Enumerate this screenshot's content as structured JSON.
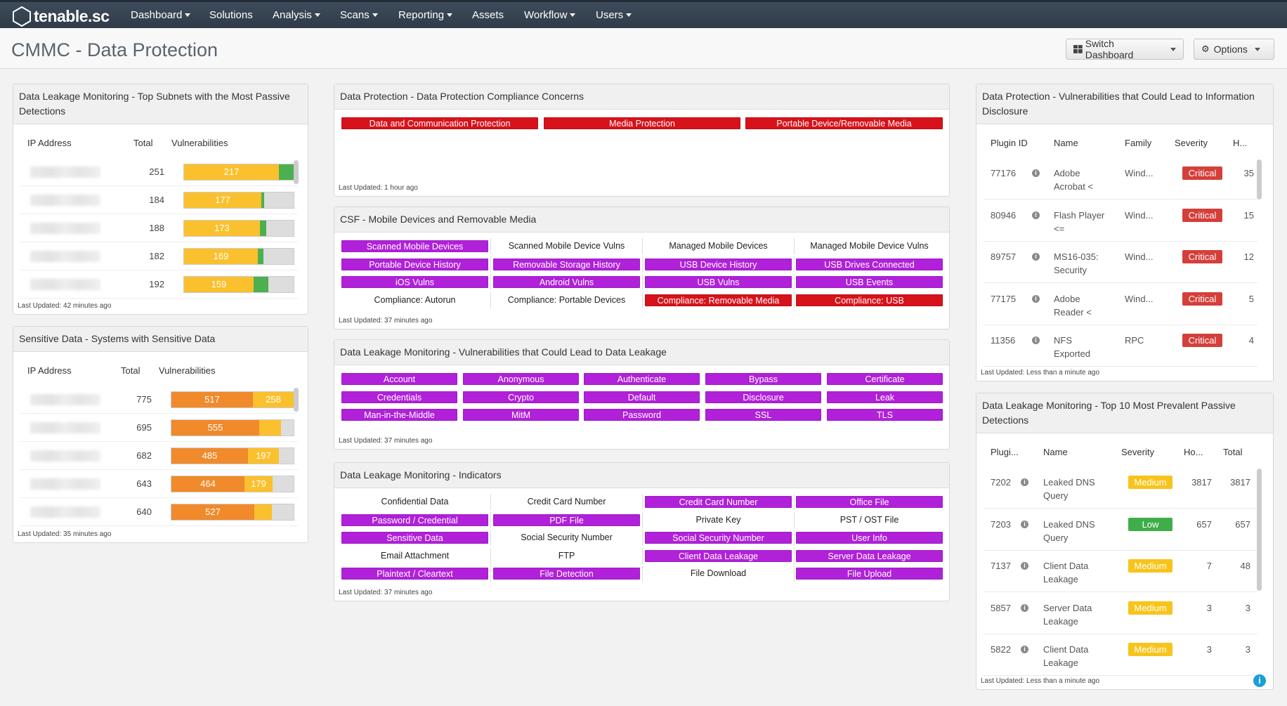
{
  "app": {
    "logo": "tenable.sc"
  },
  "nav": [
    "Dashboard",
    "Solutions",
    "Analysis",
    "Scans",
    "Reporting",
    "Assets",
    "Workflow",
    "Users"
  ],
  "page": {
    "title": "CMMC - Data Protection",
    "switch": "Switch Dashboard",
    "options": "Options"
  },
  "p1": {
    "title": "Data Leakage Monitoring - Top Subnets with the Most Passive Detections",
    "cols": [
      "IP Address",
      "Total",
      "Vulnerabilities"
    ],
    "footer": "Last Updated: 42 minutes ago",
    "rows": [
      {
        "total": "251",
        "vuln": 217,
        "label": "217"
      },
      {
        "total": "184",
        "vuln": 177,
        "label": "177"
      },
      {
        "total": "188",
        "vuln": 173,
        "label": "173"
      },
      {
        "total": "182",
        "vuln": 169,
        "label": "169"
      },
      {
        "total": "192",
        "vuln": 159,
        "label": "159"
      }
    ]
  },
  "p2": {
    "title": "Sensitive Data - Systems with Sensitive Data",
    "cols": [
      "IP Address",
      "Total",
      "Vulnerabilities"
    ],
    "footer": "Last Updated: 35 minutes ago",
    "rows": [
      {
        "total": "775",
        "a": 517,
        "b": 258,
        "la": "517",
        "lb": "258"
      },
      {
        "total": "695",
        "a": 555,
        "b": 0,
        "la": "555",
        "lb": ""
      },
      {
        "total": "682",
        "a": 485,
        "b": 197,
        "la": "485",
        "lb": "197"
      },
      {
        "total": "643",
        "a": 464,
        "b": 179,
        "la": "464",
        "lb": "179"
      },
      {
        "total": "640",
        "a": 527,
        "b": 0,
        "la": "527",
        "lb": ""
      }
    ]
  },
  "p3": {
    "title": "Data Protection - Data Protection Compliance Concerns",
    "items": [
      "Data and Communication Protection",
      "Media Protection",
      "Portable Device/Removable Media"
    ],
    "footer": "Last Updated: 1 hour ago"
  },
  "p4": {
    "title": "CSF - Mobile Devices and Removable Media",
    "footer": "Last Updated: 37 minutes ago",
    "grid": [
      [
        "Scanned Mobile Devices",
        "p"
      ],
      [
        "Scanned Mobile Device Vulns",
        "w"
      ],
      [
        "Managed Mobile Devices",
        "w"
      ],
      [
        "Managed Mobile Device Vulns",
        "w"
      ],
      [
        "Portable Device History",
        "p"
      ],
      [
        "Removable Storage History",
        "p"
      ],
      [
        "USB Device History",
        "p"
      ],
      [
        "USB Drives Connected",
        "p"
      ],
      [
        "iOS Vulns",
        "p"
      ],
      [
        "Android Vulns",
        "p"
      ],
      [
        "USB Vulns",
        "p"
      ],
      [
        "USB Events",
        "p"
      ],
      [
        "Compliance: Autorun",
        "w"
      ],
      [
        "Compliance: Portable Devices",
        "w"
      ],
      [
        "Compliance: Removable Media",
        "r"
      ],
      [
        "Compliance: USB",
        "r"
      ]
    ]
  },
  "p5": {
    "title": "Data Leakage Monitoring - Vulnerabilities that Could Lead to Data Leakage",
    "footer": "Last Updated: 37 minutes ago",
    "grid": [
      "Account",
      "Anonymous",
      "Authenticate",
      "Bypass",
      "Certificate",
      "Credentials",
      "Crypto",
      "Default",
      "Disclosure",
      "Leak",
      "Man-in-the-Middle",
      "MitM",
      "Password",
      "SSL",
      "TLS"
    ]
  },
  "p6": {
    "title": "Data Leakage Monitoring - Indicators",
    "footer": "Last Updated: 37 minutes ago",
    "grid": [
      [
        "Confidential Data",
        "w"
      ],
      [
        "Credit Card Number",
        "w"
      ],
      [
        "Credit Card Number",
        "p"
      ],
      [
        "Office File",
        "p"
      ],
      [
        "Password / Credential",
        "p"
      ],
      [
        "PDF File",
        "p"
      ],
      [
        "Private Key",
        "w"
      ],
      [
        "PST / OST File",
        "w"
      ],
      [
        "Sensitive Data",
        "p"
      ],
      [
        "Social Security Number",
        "w"
      ],
      [
        "Social Security Number",
        "p"
      ],
      [
        "User Info",
        "p"
      ],
      [
        "Email Attachment",
        "w"
      ],
      [
        "FTP",
        "w"
      ],
      [
        "Client Data Leakage",
        "p"
      ],
      [
        "Server Data Leakage",
        "p"
      ],
      [
        "Plaintext / Cleartext",
        "p"
      ],
      [
        "File Detection",
        "p"
      ],
      [
        "File Download",
        "w"
      ],
      [
        "File Upload",
        "p"
      ]
    ]
  },
  "p7": {
    "title": "Data Protection - Vulnerabilities that Could Lead to Information Disclosure",
    "cols": [
      "Plugin ID",
      "Name",
      "Family",
      "Severity",
      "H..."
    ],
    "footer": "Last Updated: Less than a minute ago",
    "rows": [
      {
        "id": "77176",
        "name": "Adobe Acrobat <",
        "family": "Wind...",
        "sev": "Critical",
        "h": "35"
      },
      {
        "id": "80946",
        "name": "Flash Player <=",
        "family": "Wind...",
        "sev": "Critical",
        "h": "15"
      },
      {
        "id": "89757",
        "name": "MS16-035: Security",
        "family": "Wind...",
        "sev": "Critical",
        "h": "12"
      },
      {
        "id": "77175",
        "name": "Adobe Reader <",
        "family": "Wind...",
        "sev": "Critical",
        "h": "5"
      },
      {
        "id": "11356",
        "name": "NFS Exported",
        "family": "RPC",
        "sev": "Critical",
        "h": "4"
      }
    ]
  },
  "p8": {
    "title": "Data Leakage Monitoring - Top 10 Most Prevalent Passive Detections",
    "cols": [
      "Plugi...",
      "Name",
      "Severity",
      "Ho...",
      "Total"
    ],
    "footer": "Last Updated: Less than a minute ago",
    "rows": [
      {
        "id": "7202",
        "name": "Leaked DNS Query",
        "sev": "Medium",
        "h": "3817",
        "t": "3817"
      },
      {
        "id": "7203",
        "name": "Leaked DNS Query",
        "sev": "Low",
        "h": "657",
        "t": "657"
      },
      {
        "id": "7137",
        "name": "Client Data Leakage",
        "sev": "Medium",
        "h": "7",
        "t": "48"
      },
      {
        "id": "5857",
        "name": "Server Data Leakage",
        "sev": "Medium",
        "h": "3",
        "t": "3"
      },
      {
        "id": "5822",
        "name": "Client Data Leakage",
        "sev": "Medium",
        "h": "3",
        "t": "3"
      }
    ]
  },
  "colors": {
    "critical": "#d43f3a",
    "medium": "#f8c41b",
    "low": "#3fae49",
    "purple": "#b021d9",
    "red": "#d7121a",
    "yellow": "#fbc02d",
    "orange": "#f08a2b",
    "green": "#4caf50"
  }
}
